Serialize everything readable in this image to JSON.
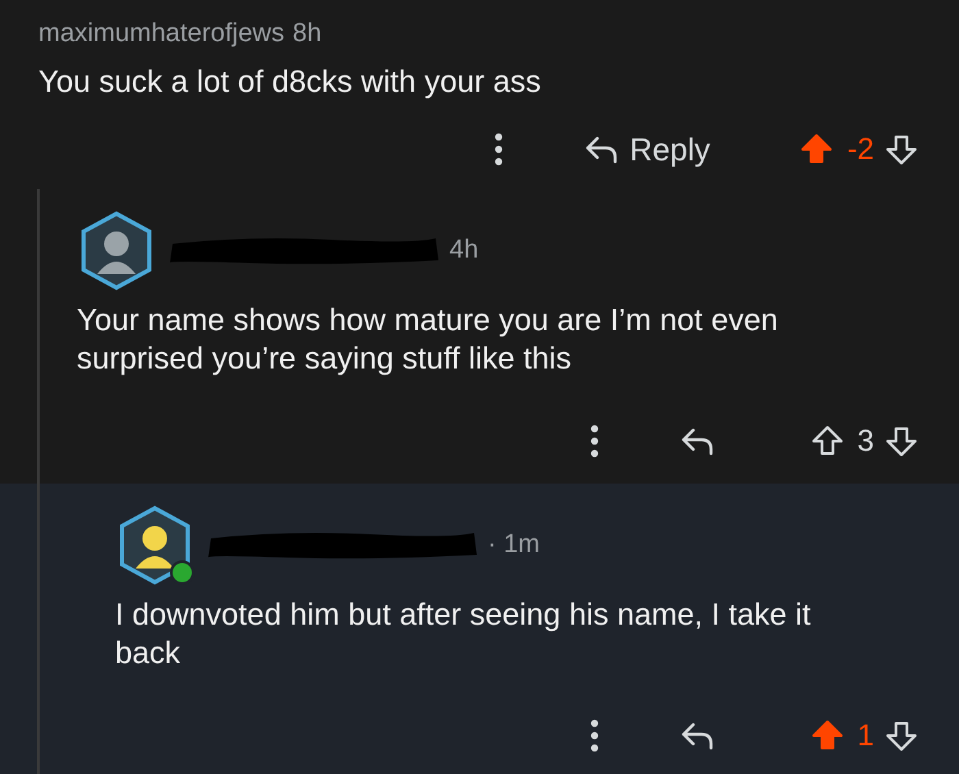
{
  "comments": [
    {
      "author": "maximumhaterofjews",
      "time": "8h",
      "body": "You suck a lot of d8cks with your ass",
      "reply_label": "Reply",
      "upvoted": true,
      "score": "-2",
      "highlighted": false,
      "children": [
        {
          "redacted": true,
          "time": "4h",
          "body": "Your name shows how mature you are I’m not even surprised you’re saying stuff like this",
          "upvoted": false,
          "score": "3",
          "highlighted": false,
          "children": [
            {
              "redacted": true,
              "online": true,
              "time": "· 1m",
              "body": "I downvoted him but after seeing his name, I take it back",
              "upvoted": true,
              "score": "1",
              "highlighted": true
            }
          ]
        }
      ]
    }
  ]
}
